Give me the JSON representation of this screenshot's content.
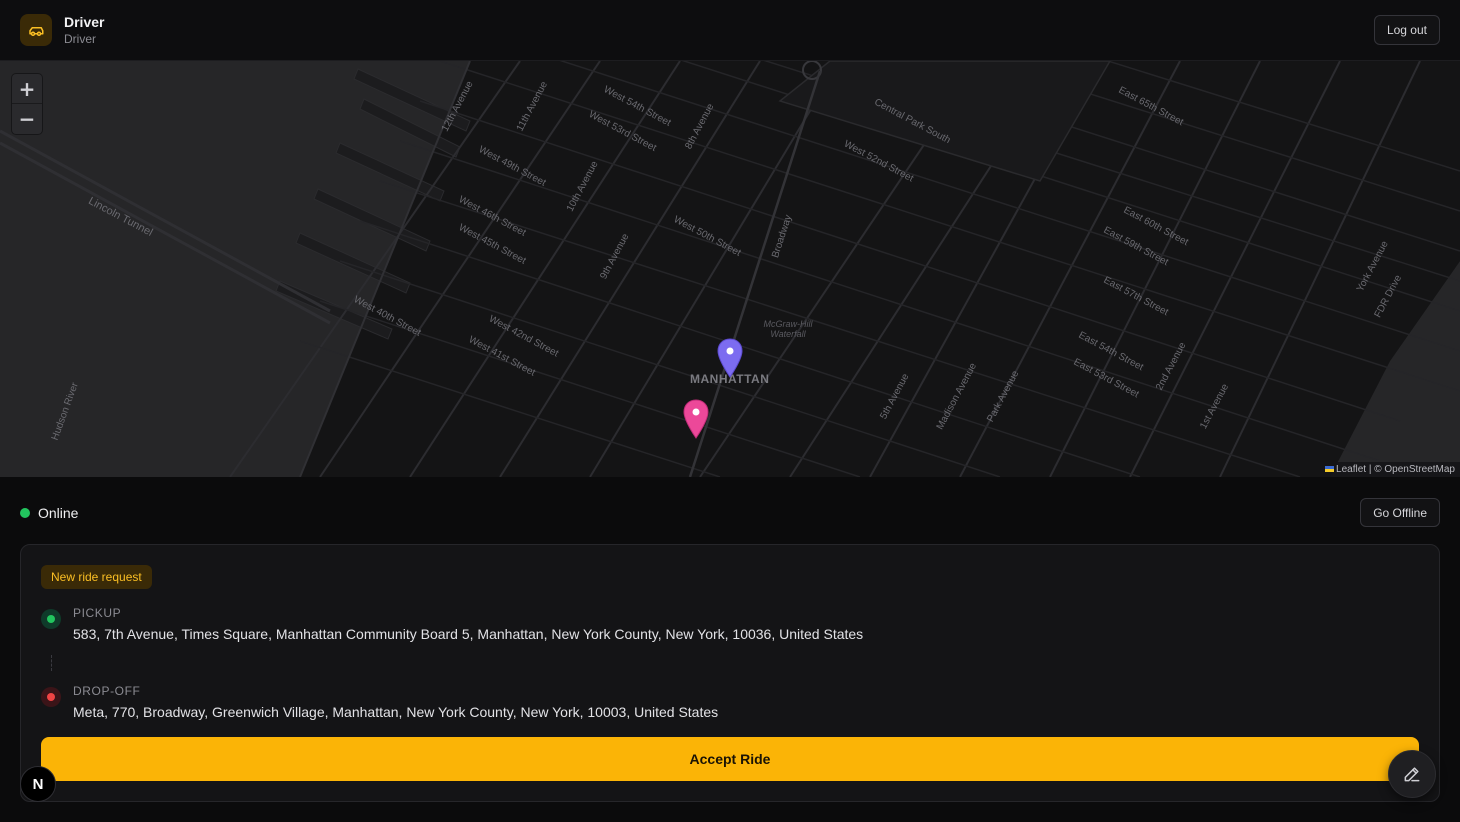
{
  "header": {
    "title": "Driver",
    "subtitle": "Driver",
    "logout_label": "Log out",
    "icon": "car-icon"
  },
  "map": {
    "zoom_in_label": "+",
    "zoom_out_label": "−",
    "attribution_leaflet": "Leaflet",
    "attribution_separator": " | © ",
    "attribution_osm": "OpenStreetMap",
    "district_label": "MANHATTAN",
    "poi_label": "McGraw-Hill Waterfall",
    "street_labels": [
      "West 54th Street",
      "West 53rd Street",
      "West 52nd Street",
      "West 49th Street",
      "West 46th Street",
      "West 45th Street",
      "West 50th Street",
      "West 42nd Street",
      "West 41st Street",
      "West 40th Street",
      "Central Park South",
      "East 65th Street",
      "East 60th Street",
      "East 59th Street",
      "East 57th Street",
      "East 54th Street",
      "East 53rd Street",
      "Lincoln Tunnel",
      "12th Avenue",
      "11th Avenue",
      "10th Avenue",
      "9th Avenue",
      "8th Avenue",
      "Broadway",
      "5th Avenue",
      "Madison Avenue",
      "Park Avenue",
      "2nd Avenue",
      "1st Avenue",
      "York Avenue",
      "FDR Drive",
      "Hudson River"
    ],
    "pickup_marker_color": "#7c6cf0",
    "dropoff_marker_color": "#ec4899"
  },
  "status": {
    "label": "Online",
    "color": "#22c55e",
    "toggle_label": "Go Offline"
  },
  "ride_request": {
    "badge": "New ride request",
    "pickup_label": "PICKUP",
    "pickup_address": "583, 7th Avenue, Times Square, Manhattan Community Board 5, Manhattan, New York County, New York, 10036, United States",
    "dropoff_label": "DROP-OFF",
    "dropoff_address": "Meta, 770, Broadway, Greenwich Village, Manhattan, New York County, New York, 10003, United States",
    "accept_label": "Accept Ride",
    "accent_color": "#fbb406"
  },
  "dev_badge": {
    "label": "N"
  }
}
